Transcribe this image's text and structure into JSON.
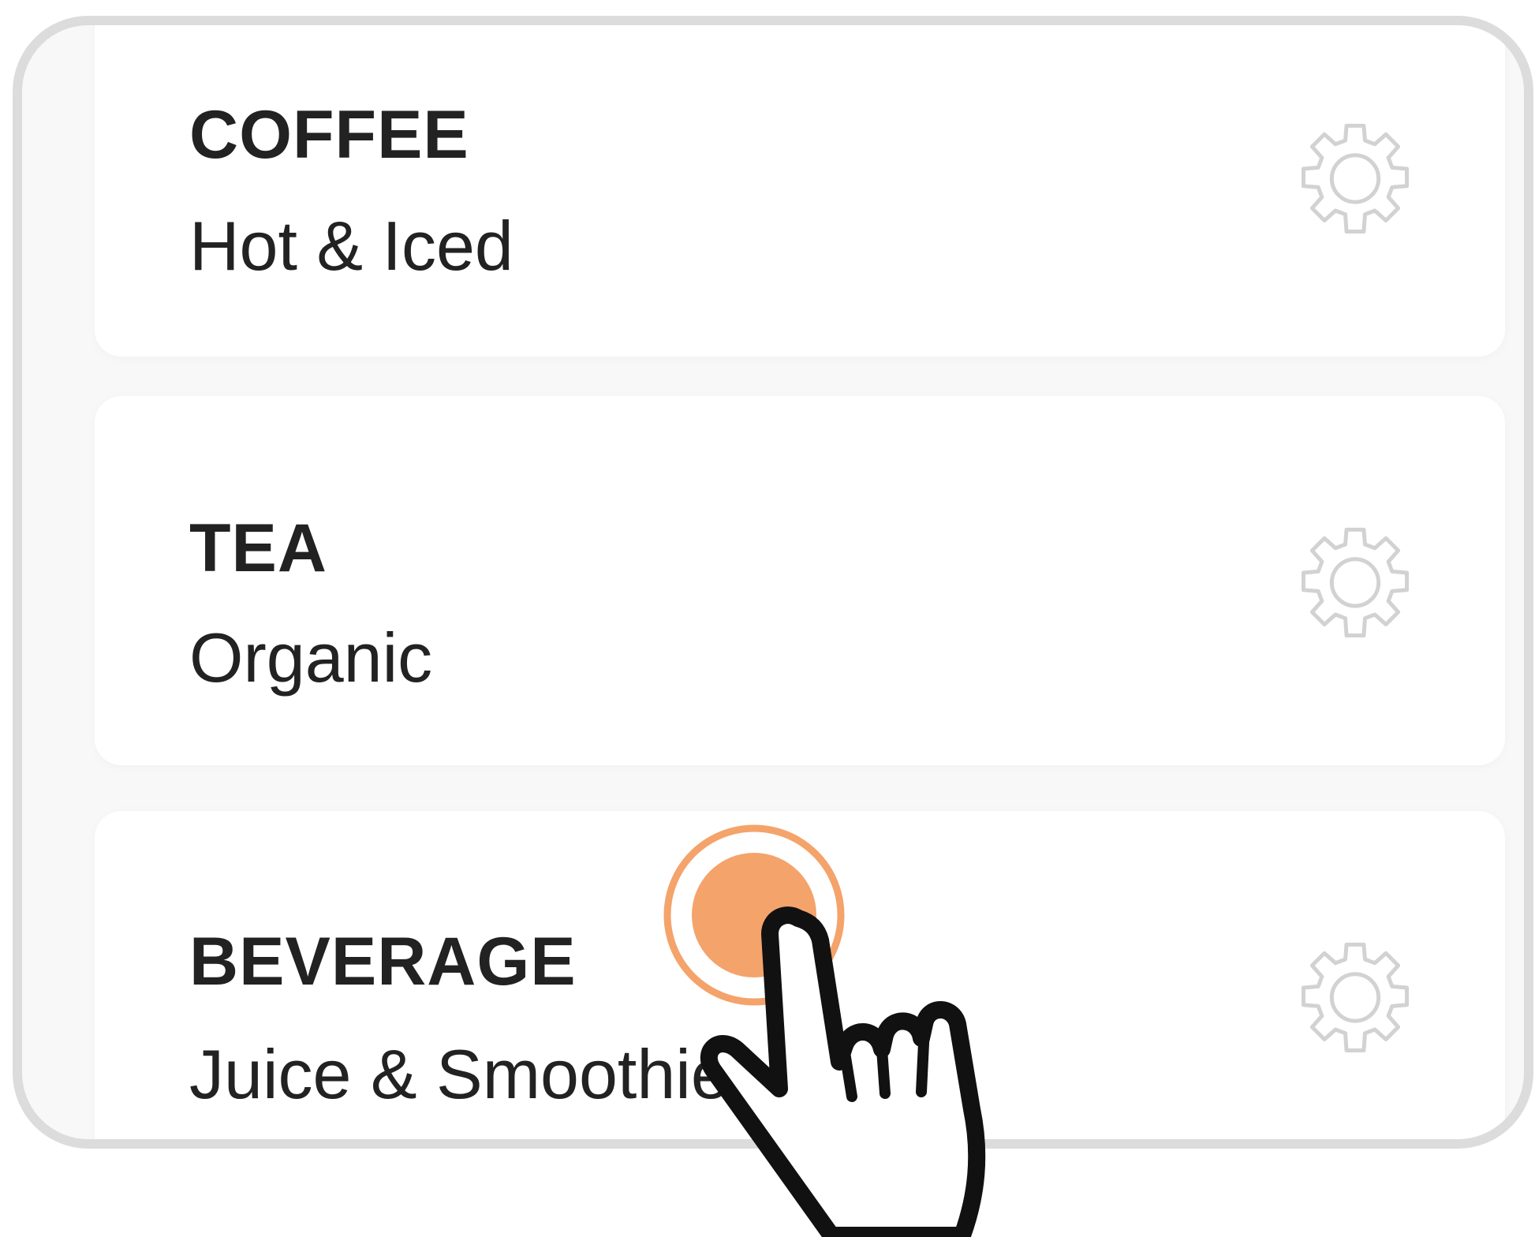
{
  "categories": [
    {
      "title": "COFFEE",
      "subtitle": "Hot & Iced",
      "icon": "gear-icon"
    },
    {
      "title": "TEA",
      "subtitle": "Organic",
      "icon": "gear-icon"
    },
    {
      "title": "BEVERAGE",
      "subtitle": "Juice & Smoothie",
      "icon": "gear-icon"
    }
  ],
  "colors": {
    "frame_border": "#dcdcdc",
    "card_background": "#ffffff",
    "text": "#222222",
    "gear_stroke": "#d2d2d2",
    "tap_accent": "#f4a36b"
  },
  "overlay": {
    "tap_indicator_icon": "tap-indicator-icon",
    "hand_icon": "hand-pointer-icon"
  }
}
